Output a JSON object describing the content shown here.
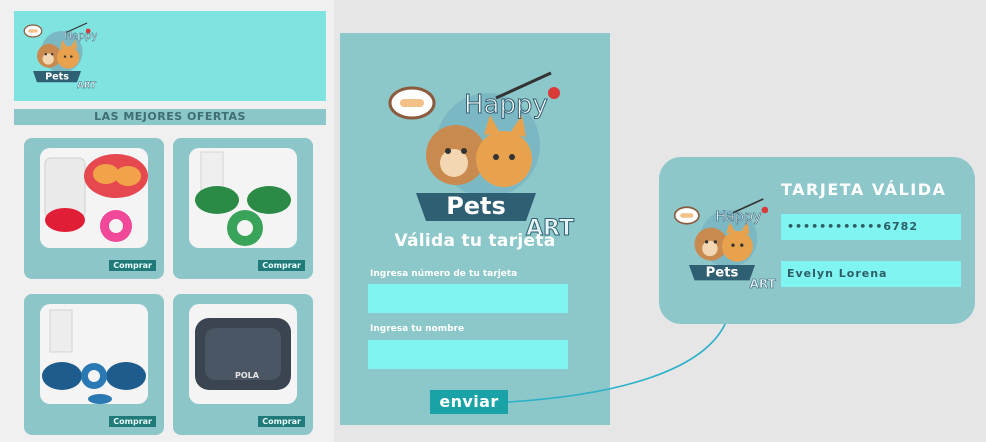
{
  "logo": {
    "brand_top": "Happy",
    "brand_mid": "Pets",
    "brand_sub": "ART"
  },
  "store": {
    "banner": "LAS MEJORES OFERTAS",
    "products": [
      {
        "name": "bowl-red",
        "buy_label": "Comprar",
        "color": "#e5484f"
      },
      {
        "name": "bowl-green",
        "buy_label": "Comprar",
        "color": "#2c8a47"
      },
      {
        "name": "bowl-blue",
        "buy_label": "Comprar",
        "color": "#1e5c8e"
      },
      {
        "name": "pet-bed",
        "buy_label": "Comprar",
        "color": "#3b4552",
        "bed_text": "POLA"
      }
    ]
  },
  "form": {
    "title": "Válida tu tarjeta",
    "card_number_label": "Ingresa número de tu tarjeta",
    "name_label": "Ingresa tu nombre",
    "submit_label": "enviar"
  },
  "result": {
    "title": "TARJETA VÁLIDA",
    "masked_number": "••••••••••••6782",
    "holder_name": "Evelyn Lorena"
  },
  "colors": {
    "panel": "#8cc7c9",
    "input": "#7ff4f1",
    "button": "#19a3a6",
    "connector": "#2bb1c9"
  }
}
